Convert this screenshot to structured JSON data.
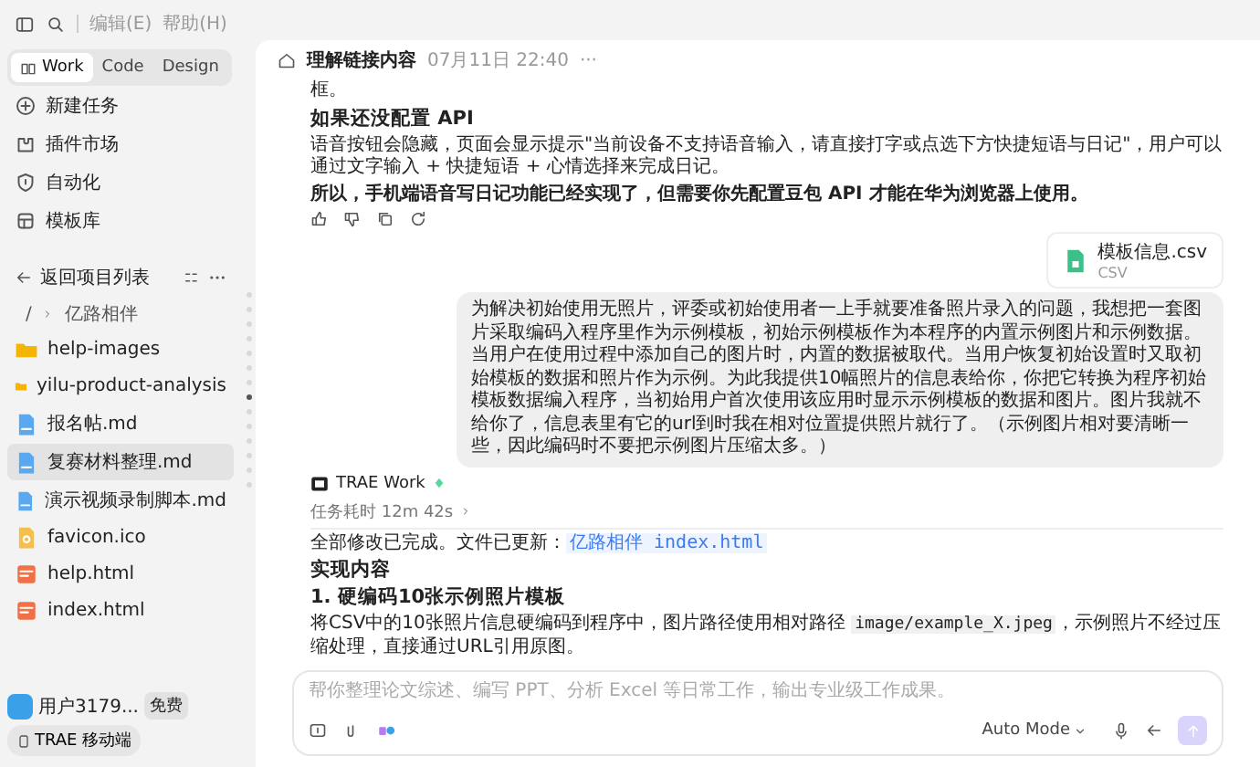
{
  "top_bar": {
    "menus": [
      "编辑(E)",
      "帮助(H)"
    ]
  },
  "mode_tabs": [
    {
      "label": "Work",
      "selected": true
    },
    {
      "label": "Code",
      "selected": false
    },
    {
      "label": "Design",
      "selected": false
    }
  ],
  "nav": [
    {
      "label": "新建任务",
      "kind": "new"
    },
    {
      "label": "插件市场",
      "kind": "plugin"
    },
    {
      "label": "自动化",
      "kind": "auto"
    },
    {
      "label": "模板库",
      "kind": "template"
    }
  ],
  "project": {
    "back_label": "返回项目列表",
    "breadcrumb": {
      "root": "/",
      "folder": "亿路相伴"
    },
    "files": [
      {
        "name": "help-images",
        "kind": "folder",
        "selected": false
      },
      {
        "name": "yilu-product-analysis",
        "kind": "folder",
        "selected": false
      },
      {
        "name": "报名帖.md",
        "kind": "md",
        "selected": false
      },
      {
        "name": "复赛材料整理.md",
        "kind": "md",
        "selected": true
      },
      {
        "name": "演示视频录制脚本.md",
        "kind": "md",
        "selected": false
      },
      {
        "name": "favicon.ico",
        "kind": "ico",
        "selected": false
      },
      {
        "name": "help.html",
        "kind": "html",
        "selected": false
      },
      {
        "name": "index.html",
        "kind": "html",
        "selected": false
      }
    ]
  },
  "user": {
    "name": "用户3179...",
    "plan": "免费",
    "mobile_button": "TRAE 移动端"
  },
  "nav_dots": [
    {
      "selected": false
    },
    {
      "selected": false
    },
    {
      "selected": false
    },
    {
      "selected": false
    },
    {
      "selected": false
    },
    {
      "selected": false
    },
    {
      "selected": false
    },
    {
      "selected": true
    },
    {
      "selected": false
    },
    {
      "selected": false
    },
    {
      "selected": false
    },
    {
      "selected": false
    },
    {
      "selected": false
    },
    {
      "selected": false
    }
  ],
  "header": {
    "title": "理解链接内容",
    "time": "07月11日 22:40",
    "more": "···"
  },
  "reply_1": {
    "tail": "框。",
    "heading": "如果还没配置 API",
    "paragraph": "语音按钮会隐藏，页面会显示提示\"当前设备不支持语音输入，请直接打字或点选下方快捷短语与日记\"，用户可以通过文字输入 + 快捷短语 + 心情选择来完成日记。",
    "conclusion": "所以，手机端语音写日记功能已经实现了，但需要你先配置豆包 API 才能在华为浏览器上使用。"
  },
  "attachment": {
    "name": "模板信息.csv",
    "type": "CSV"
  },
  "user_message": "为解决初始使用无照片，评委或初始使用者一上手就要准备照片录入的问题，我想把一套图片采取编码入程序里作为示例模板，初始示例模板作为本程序的内置示例图片和示例数据。当用户在使用过程中添加自己的图片时，内置的数据被取代。当用户恢复初始设置时又取初始模板的数据和照片作为示例。为此我提供10幅照片的信息表给你，你把它转换为程序初始模板数据编入程序，当初始用户首次使用该应用时显示示例模板的数据和图片。图片我就不给你了，信息表里有它的url到时我在相对位置提供照片就行了。（示例图片相对要清晰一些，因此编码时不要把示例图片压缩太多。）",
  "reply_2": {
    "agent": "TRAE Work",
    "duration": "任务耗时 12m 42s",
    "status": "全部修改已完成。文件已更新：",
    "file_link": "亿路相伴 index.html",
    "heading": "实现内容",
    "subheading": "1. 硬编码10张示例照片模板",
    "text_before": "将CSV中的10张照片信息硬编码到程序中，图片路径使用相对路径",
    "code": "image/example_X.jpeg",
    "text_after": "，示例照片不经过压缩处理，直接通过URL引用原图。"
  },
  "composer": {
    "placeholder": "帮你整理论文综述、编写 PPT、分析 Excel 等日常工作，输出专业级工作成果。",
    "mode": "Auto Mode"
  }
}
